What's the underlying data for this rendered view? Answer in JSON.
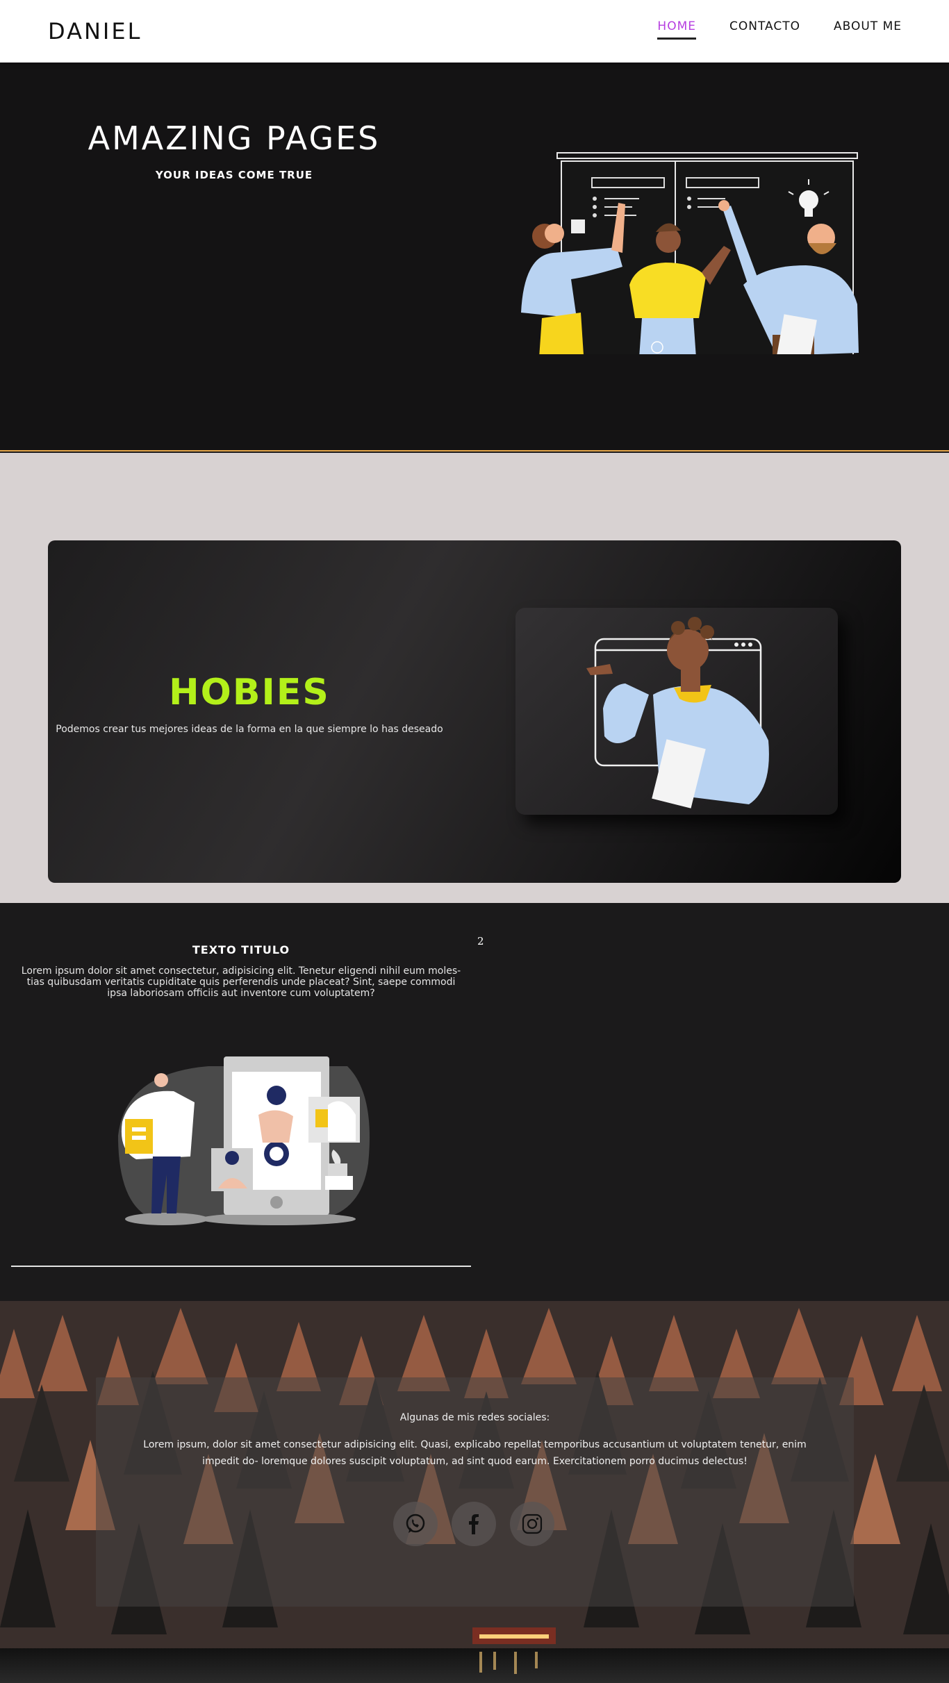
{
  "nav": {
    "logo": "DANIEL",
    "links": [
      {
        "label": "HOME",
        "active": true
      },
      {
        "label": "CONTACTO",
        "active": false
      },
      {
        "label": "ABOUT ME",
        "active": false
      }
    ],
    "active_color": "#b63ee0"
  },
  "hero": {
    "title": "AMAZING PAGES",
    "subtitle": "YOUR IDEAS COME TRUE"
  },
  "hobies": {
    "title": "HOBIES",
    "description": "Podemos crear tus mejores ideas de la forma en la que siempre lo has deseado",
    "accent_color": "#b3f01a"
  },
  "texto": {
    "title": "TEXTO TITULO",
    "body": "Lorem ipsum dolor sit amet consectetur, adipisicing elit. Tenetur eligendi nihil eum moles- tias quibusdam veritatis cupiditate quis perferendis unde placeat? Sint, saepe commodi ipsa laboriosam officiis aut inventore cum voluptatem?",
    "counter": "2"
  },
  "social": {
    "title": "Algunas de mis redes sociales:",
    "body": "Lorem ipsum, dolor sit amet consectetur adipisicing elit. Quasi, explicabo repellat temporibus accusantium ut voluptatem tenetur, enim impedit do- loremque dolores suscipit voluptatum, ad sint quod earum. Exercitationem porro ducimus delectus!",
    "icons": [
      "whatsapp-icon",
      "facebook-icon",
      "instagram-icon"
    ]
  }
}
